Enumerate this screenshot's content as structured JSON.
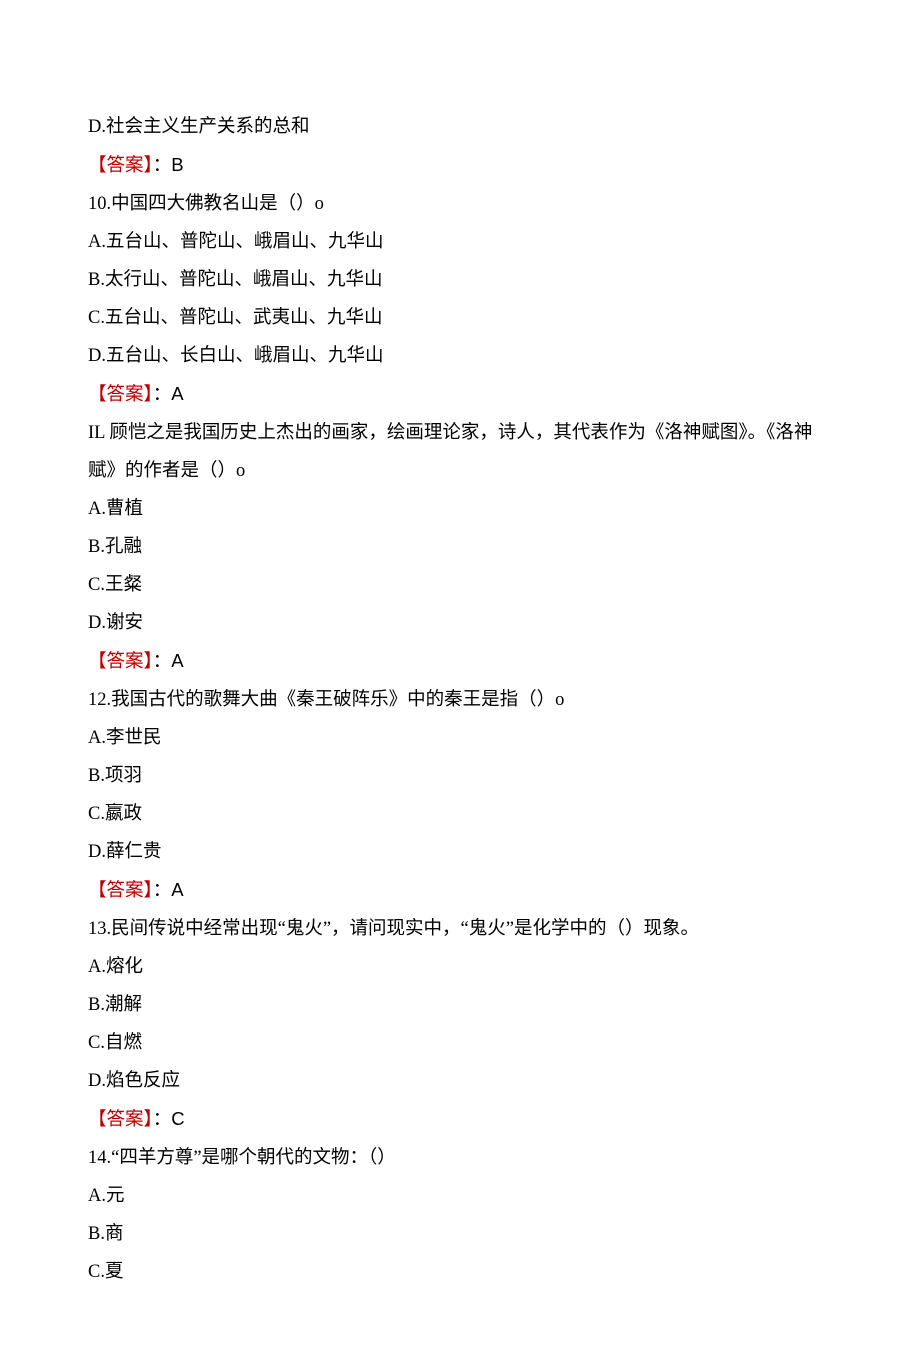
{
  "lines": [
    {
      "type": "text",
      "content": "D.社会主义生产关系的总和"
    },
    {
      "type": "answer",
      "label": "【答案】",
      "colon": "：",
      "value": "B"
    },
    {
      "type": "text",
      "content": "10.中国四大佛教名山是（）o"
    },
    {
      "type": "text",
      "content": "A.五台山、普陀山、峨眉山、九华山"
    },
    {
      "type": "text",
      "content": "B.太行山、普陀山、峨眉山、九华山"
    },
    {
      "type": "text",
      "content": "C.五台山、普陀山、武夷山、九华山"
    },
    {
      "type": "text",
      "content": "D.五台山、长白山、峨眉山、九华山"
    },
    {
      "type": "answer",
      "label": "【答案】",
      "colon": "：",
      "value": "A"
    },
    {
      "type": "text",
      "content": "IL 顾恺之是我国历史上杰出的画家，绘画理论家，诗人，其代表作为《洛神赋图》。《洛神"
    },
    {
      "type": "text",
      "content": "赋》的作者是（）o"
    },
    {
      "type": "text",
      "content": "A.曹植"
    },
    {
      "type": "text",
      "content": "B.孔融"
    },
    {
      "type": "text",
      "content": "C.王粲"
    },
    {
      "type": "text",
      "content": "D.谢安"
    },
    {
      "type": "answer",
      "label": "【答案】",
      "colon": "：",
      "value": "A"
    },
    {
      "type": "text",
      "content": "12.我国古代的歌舞大曲《秦王破阵乐》中的秦王是指（）o"
    },
    {
      "type": "text",
      "content": "A.李世民"
    },
    {
      "type": "text",
      "content": "B.项羽"
    },
    {
      "type": "text",
      "content": "C.嬴政"
    },
    {
      "type": "text",
      "content": "D.薛仁贵"
    },
    {
      "type": "answer",
      "label": "【答案】",
      "colon": "：",
      "value": "A"
    },
    {
      "type": "text",
      "content": "13.民间传说中经常出现“鬼火”，请问现实中，“鬼火”是化学中的（）现象。"
    },
    {
      "type": "text",
      "content": "A.熔化"
    },
    {
      "type": "text",
      "content": "B.潮解"
    },
    {
      "type": "text",
      "content": "C.自燃"
    },
    {
      "type": "text",
      "content": "D.焰色反应"
    },
    {
      "type": "answer",
      "label": "【答案】",
      "colon": "：",
      "value": "C"
    },
    {
      "type": "text",
      "content": "14.“四羊方尊”是哪个朝代的文物：（）"
    },
    {
      "type": "text",
      "content": "A.元"
    },
    {
      "type": "text",
      "content": "B.商"
    },
    {
      "type": "text",
      "content": "C.夏"
    }
  ]
}
